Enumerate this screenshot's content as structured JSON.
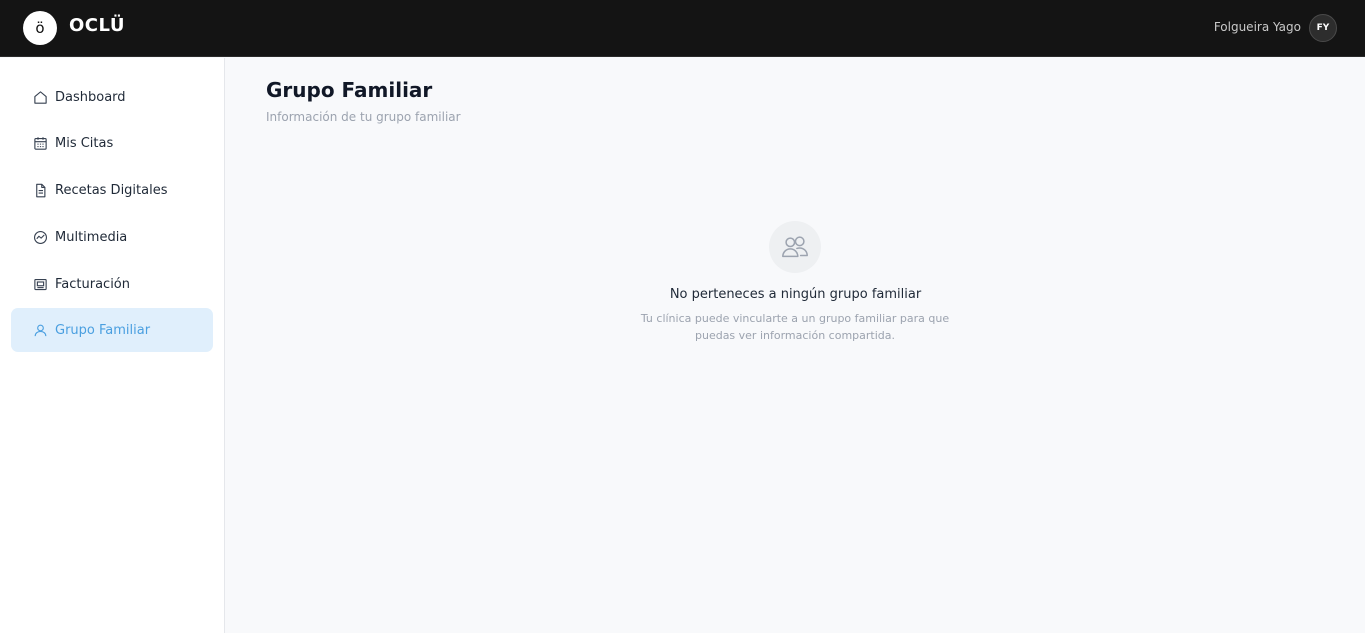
{
  "header": {
    "logo_glyph": "ö",
    "brand": "OCLÜ",
    "user_name": "Folgueira Yago",
    "avatar_initials": "FY"
  },
  "sidebar": {
    "items": [
      {
        "label": "Dashboard",
        "icon": "home-icon"
      },
      {
        "label": "Mis Citas",
        "icon": "calendar-icon"
      },
      {
        "label": "Recetas Digitales",
        "icon": "document-icon"
      },
      {
        "label": "Multimedia",
        "icon": "chart-circle-icon"
      },
      {
        "label": "Facturación",
        "icon": "invoice-icon"
      },
      {
        "label": "Grupo Familiar",
        "icon": "user-icon",
        "active": true
      }
    ]
  },
  "main": {
    "title": "Grupo Familiar",
    "subtitle": "Información de tu grupo familiar",
    "empty_state": {
      "icon": "users-icon",
      "title": "No perteneces a ningún grupo familiar",
      "description": "Tu clínica puede vincularte a un grupo familiar para que puedas ver información compartida."
    }
  },
  "colors": {
    "topbar": "#141414",
    "accent": "#4a9fe0",
    "active_bg": "#e0effc",
    "page_bg": "#f8f9fb"
  }
}
